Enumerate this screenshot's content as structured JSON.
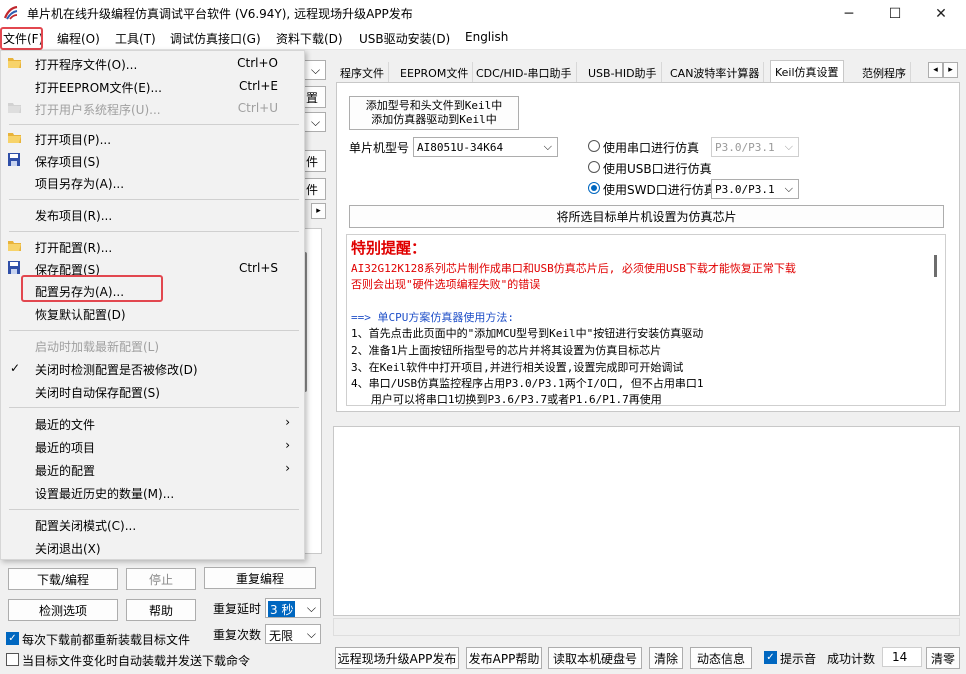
{
  "window": {
    "title": "单片机在线升级编程仿真调试平台软件 (V6.94Y), 远程现场升级APP发布",
    "icon": "app-logo-icon",
    "minimize_glyph": "─",
    "maximize_glyph": "☐",
    "close_glyph": "✕"
  },
  "menubar": {
    "items": [
      "文件(F)",
      "编程(O)",
      "工具(T)",
      "调试仿真接口(G)",
      "资料下载(D)",
      "USB驱动安装(D)",
      "English"
    ]
  },
  "file_menu": {
    "items": [
      {
        "label": "打开程序文件(O)...",
        "shortcut": "Ctrl+O",
        "icon": "open-folder-icon"
      },
      {
        "label": "打开EEPROM文件(E)...",
        "shortcut": "Ctrl+E"
      },
      {
        "label": "打开用户系统程序(U)...",
        "shortcut": "Ctrl+U",
        "icon": "open-folder-icon"
      },
      {
        "label": "打开项目(P)...",
        "icon": "open-folder-icon"
      },
      {
        "label": "保存项目(S)",
        "icon": "save-disk-icon"
      },
      {
        "label": "项目另存为(A)..."
      },
      {
        "label": "发布项目(R)..."
      },
      {
        "label": "打开配置(R)...",
        "icon": "open-folder-icon"
      },
      {
        "label": "保存配置(S)",
        "shortcut": "Ctrl+S",
        "icon": "save-disk-icon"
      },
      {
        "label": "配置另存为(A)..."
      },
      {
        "label": "恢复默认配置(D)"
      },
      {
        "label": "启动时加载最新配置(L)"
      },
      {
        "label": "关闭时检测配置是否被修改(D)",
        "check": "✓"
      },
      {
        "label": "关闭时自动保存配置(S)"
      },
      {
        "label": "最近的文件",
        "arrow": "›"
      },
      {
        "label": "最近的项目",
        "arrow": "›"
      },
      {
        "label": "最近的配置",
        "arrow": "›"
      },
      {
        "label": "设置最近历史的数量(M)..."
      },
      {
        "label": "配置关闭模式(C)..."
      },
      {
        "label": "关闭退出(X)"
      }
    ]
  },
  "left_panel": {
    "peek": {
      "btn1": "置",
      "btn2": "件",
      "btn3": "件"
    },
    "download_btn": "下载/编程",
    "stop_btn": "停止",
    "reprogram_btn": "重复编程",
    "detect_btn": "检测选项",
    "help_btn": "帮助",
    "repeat_delay_label": "重复延时",
    "repeat_delay_value": "3 秒",
    "repeat_count_label": "重复次数",
    "repeat_count_value": "无限",
    "reload_checkbox": "每次下载前都重新装载目标文件",
    "auto_send_checkbox": "当目标文件变化时自动装载并发送下载命令"
  },
  "tabs": {
    "items": [
      "程序文件",
      "EEPROM文件",
      "CDC/HID-串口助手",
      "USB-HID助手",
      "CAN波特率计算器",
      "Keil仿真设置",
      "范例程序"
    ],
    "selected": "Keil仿真设置",
    "scroll_left": "◂",
    "scroll_right": "▸"
  },
  "keil": {
    "add_btn_line1": "添加型号和头文件到Keil中",
    "add_btn_line2": "添加仿真器驱动到Keil中",
    "mcu_label": "单片机型号",
    "mcu_value": "AI8051U-34K64",
    "radio_serial": "使用串口进行仿真",
    "serial_port": "P3.0/P3.1",
    "radio_usb": "使用USB口进行仿真",
    "radio_swd": "使用SWD口进行仿真",
    "swd_port": "P3.0/P3.1",
    "selected_mode": "swd",
    "set_target_btn": "将所选目标单片机设置为仿真芯片"
  },
  "notes": {
    "title": "特别提醒：",
    "warn1": "AI32G12K128系列芯片制作成串口和USB仿真芯片后, 必须使用USB下载才能恢复正常下载",
    "warn2": "否则会出现\"硬件选项编程失败\"的错误",
    "subtitle": "==> 单CPU方案仿真器使用方法:",
    "lines": [
      "1、首先点击此页面中的\"添加MCU型号到Keil中\"按钮进行安装仿真驱动",
      "2、准备1片上面按钮所指型号的芯片并将其设置为仿真目标芯片",
      "3、在Keil软件中打开项目,并进行相关设置,设置完成即可开始调试",
      "4、串口/USB仿真监控程序占用P3.0/P3.1两个I/O口, 但不占用串口1",
      "   用户可以将串口1切换到P3.6/P3.7或者P1.6/P1.7再使用"
    ],
    "warn_color": "#e00000"
  },
  "bottom_bar": {
    "publish_btn": "远程现场升级APP发布",
    "app_help_btn": "发布APP帮助",
    "read_disk_btn": "读取本机硬盘号",
    "clear_btn": "清除",
    "dynamic_btn": "动态信息",
    "beep_label": "提示音",
    "success_label": "成功计数",
    "success_count": "14",
    "reset_btn": "清零"
  },
  "colors": {
    "accent": "#0067c0",
    "highlight": "#e2474f",
    "warn": "#e00000"
  }
}
